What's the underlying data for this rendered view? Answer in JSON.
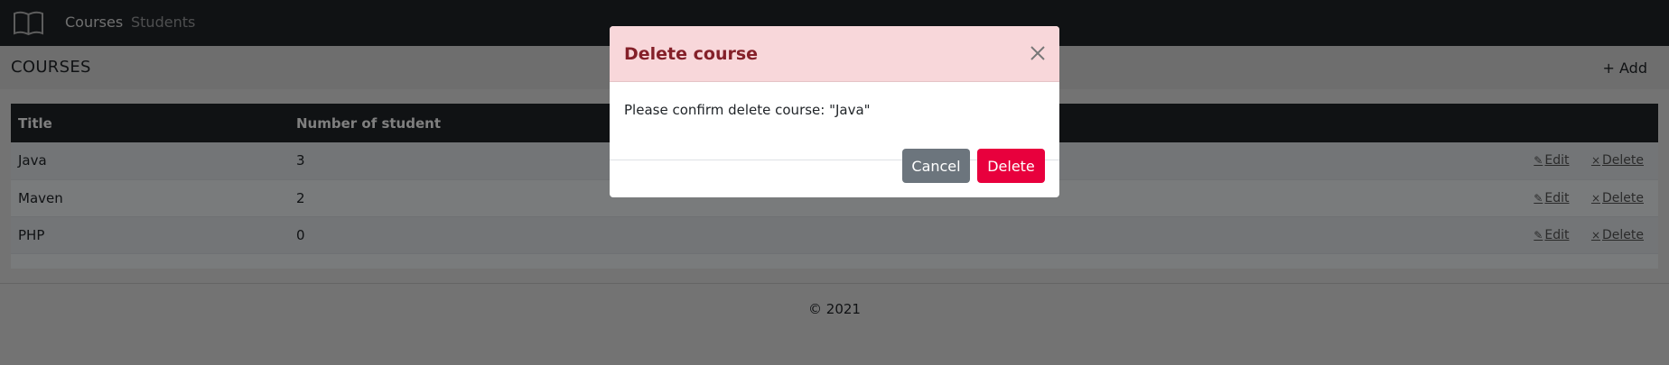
{
  "navbar": {
    "brand_icon": "book-icon",
    "links": [
      {
        "label": "Courses"
      },
      {
        "label": "Students"
      }
    ]
  },
  "page": {
    "title": "COURSES",
    "add_label": "Add",
    "add_icon": "+"
  },
  "table": {
    "columns": [
      "Title",
      "Number of student"
    ],
    "rows": [
      {
        "title": "Java",
        "count": "3",
        "edit": "Edit",
        "delete": "Delete"
      },
      {
        "title": "Maven",
        "count": "2",
        "edit": "Edit",
        "delete": "Delete"
      },
      {
        "title": "PHP",
        "count": "0",
        "edit": "Edit",
        "delete": "Delete"
      }
    ]
  },
  "footer": {
    "text": "© 2021"
  },
  "modal": {
    "title": "Delete course",
    "body": "Please confirm delete course: \"Java\"",
    "cancel_label": "Cancel",
    "delete_label": "Delete"
  },
  "colors": {
    "navbar_bg": "#212529",
    "modal_header_bg": "#f8d7da",
    "modal_title": "#842029",
    "delete_button": "#e8003d",
    "cancel_button": "#6c757d"
  }
}
